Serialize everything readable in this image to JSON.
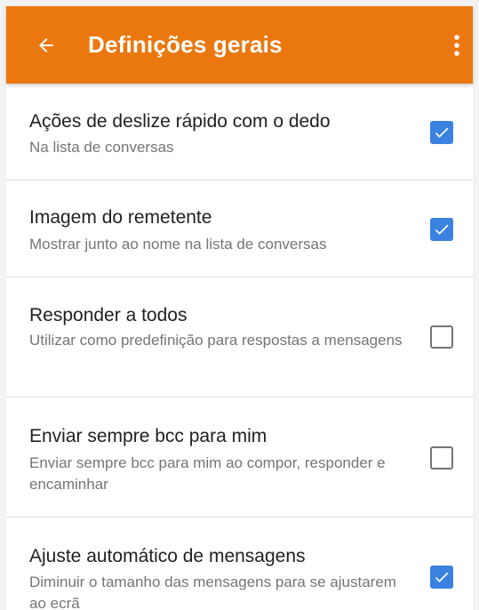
{
  "app_bar": {
    "title": "Definições gerais",
    "back_icon": "arrow-left-icon",
    "menu_icon": "more-vert-icon",
    "color": "#ea780e"
  },
  "settings": [
    {
      "title": "Ações de deslize rápido com o dedo",
      "subtitle": "Na lista de conversas",
      "checked": true
    },
    {
      "title": "Imagem do remetente",
      "subtitle": "Mostrar junto ao nome na lista de conversas",
      "checked": true
    },
    {
      "title": "Responder a todos",
      "subtitle": "Utilizar como predefinição para respostas a mensagens",
      "checked": false
    },
    {
      "title": "Enviar sempre bcc para mim",
      "subtitle": "Enviar sempre bcc para mim ao compor, responder e encaminhar",
      "checked": false
    },
    {
      "title": "Ajuste automático de mensagens",
      "subtitle": "Diminuir o tamanho das mensagens para se ajustarem ao ecrã",
      "checked": true
    }
  ],
  "colors": {
    "checkbox_checked": "#3b82e0",
    "checkbox_unchecked_border": "#757575"
  }
}
